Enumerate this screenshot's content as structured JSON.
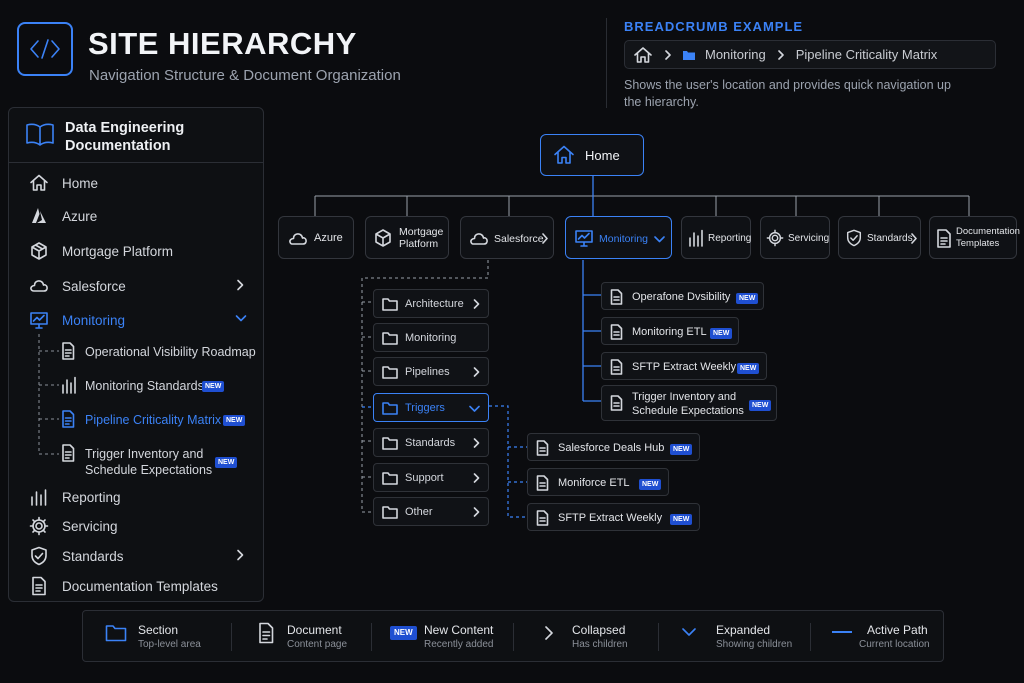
{
  "header": {
    "title": "SITE HIERARCHY",
    "subtitle": "Navigation Structure & Document Organization",
    "logo_icon": "code-icon"
  },
  "breadcrumb_example": {
    "heading": "BREADCRUMB EXAMPLE",
    "items": [
      "Monitoring",
      "Pipeline Criticality Matrix"
    ],
    "description": "Shows the user's location and provides quick navigation up the hierarchy."
  },
  "sidebar": {
    "title_line1": "Data Engineering",
    "title_line2": "Documentation",
    "items": [
      {
        "label": "Home",
        "icon": "home-icon"
      },
      {
        "label": "Azure",
        "icon": "azure-icon"
      },
      {
        "label": "Mortgage Platform",
        "icon": "cube-icon"
      },
      {
        "label": "Salesforce",
        "icon": "cloud-icon"
      },
      {
        "label": "Monitoring",
        "icon": "monitor-chart-icon"
      },
      {
        "label": "Reporting",
        "icon": "bar-chart-icon"
      },
      {
        "label": "Servicing",
        "icon": "gear-icon"
      },
      {
        "label": "Standards",
        "icon": "shield-icon"
      },
      {
        "label": "Documentation Templates",
        "icon": "document-icon"
      }
    ],
    "monitoring_children": [
      {
        "label": "Operational Visibility Roadmap",
        "badge": ""
      },
      {
        "label": "Monitoring Standards",
        "badge": "NEW"
      },
      {
        "label": "Pipeline Criticality Matrix",
        "badge": "NEW"
      },
      {
        "label_line1": "Trigger Inventory and",
        "label_line2": "Schedule Expectations",
        "badge": "NEW"
      }
    ]
  },
  "diagram": {
    "root": "Home",
    "top_nodes": [
      {
        "label": "Azure"
      },
      {
        "label_line1": "Mortgage",
        "label_line2": "Platform"
      },
      {
        "label": "Salesforce"
      },
      {
        "label": "Monitoring"
      },
      {
        "label": "Reporting"
      },
      {
        "label": "Servicing"
      },
      {
        "label": "Standards"
      },
      {
        "label_line1": "Documentation",
        "label_line2": "Templates"
      }
    ],
    "salesforce_sections": [
      "Architecture",
      "Monitoring",
      "Pipelines",
      "Triggers",
      "Standards",
      "Support",
      "Other"
    ],
    "trigger_docs": [
      {
        "label": "Salesforce Deals Hub",
        "badge": "NEW"
      },
      {
        "label": "Moniforce ETL",
        "badge": "NEW"
      },
      {
        "label": "SFTP Extract Weekly",
        "badge": "NEW"
      }
    ],
    "monitoring_docs": [
      {
        "label": "Operafone Dvsibility",
        "badge": "NEW"
      },
      {
        "label": "Monitoring ETL",
        "badge": "NEW"
      },
      {
        "label": "SFTP Extract Weekly",
        "badge": "NEW"
      },
      {
        "label_line1": "Trigger Inventory and",
        "label_line2": "Schedule Expectations",
        "badge": "NEW"
      }
    ]
  },
  "legend": [
    {
      "title": "Section",
      "desc": "Top-level area",
      "icon": "folder-icon"
    },
    {
      "title": "Document",
      "desc": "Content page",
      "icon": "document-icon"
    },
    {
      "title": "New Content",
      "desc": "Recently added",
      "badge": "NEW"
    },
    {
      "title": "Collapsed",
      "desc": "Has children",
      "icon": "chevron-right-icon"
    },
    {
      "title": "Expanded",
      "desc": "Showing children",
      "icon": "chevron-down-icon"
    },
    {
      "title": "Active Path",
      "desc": "Current location",
      "icon": "active-path-line-icon"
    }
  ],
  "colors": {
    "accent": "#3b82f6",
    "background": "#0b0c0f",
    "badge": "#1f4fd1"
  }
}
